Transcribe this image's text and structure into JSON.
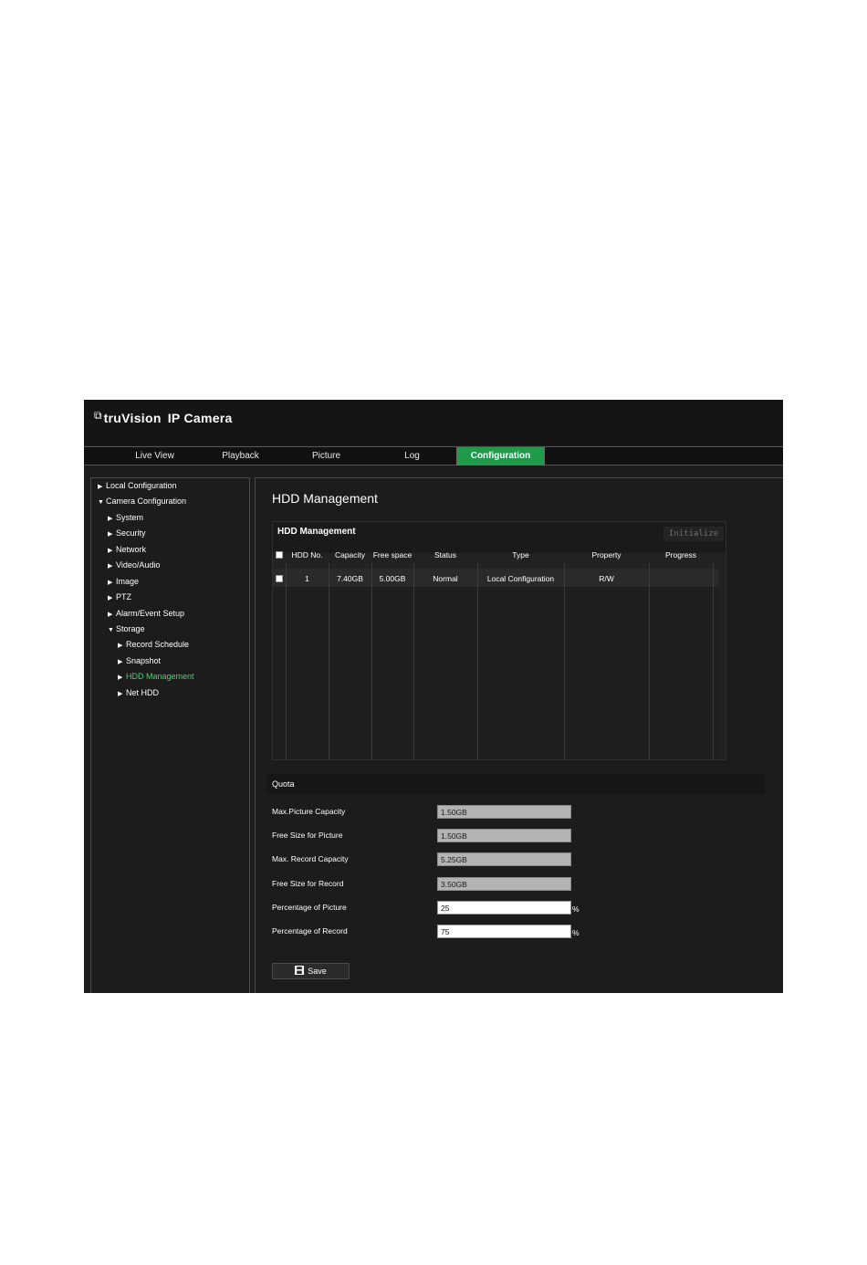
{
  "header": {
    "logo_mark": "⧉",
    "brand": "truVision",
    "product": "IP Camera"
  },
  "nav": {
    "tabs": [
      {
        "label": "Live View"
      },
      {
        "label": "Playback"
      },
      {
        "label": "Picture"
      },
      {
        "label": "Log"
      },
      {
        "label": "Configuration",
        "active": true
      }
    ]
  },
  "sidebar": {
    "items": [
      {
        "label": "Local Configuration",
        "arrow": "▶",
        "level": 0
      },
      {
        "label": "Camera Configuration",
        "arrow": "▼",
        "level": 0
      },
      {
        "label": "System",
        "arrow": "▶",
        "level": 1
      },
      {
        "label": "Security",
        "arrow": "▶",
        "level": 1
      },
      {
        "label": "Network",
        "arrow": "▶",
        "level": 1
      },
      {
        "label": "Video/Audio",
        "arrow": "▶",
        "level": 1
      },
      {
        "label": "Image",
        "arrow": "▶",
        "level": 1
      },
      {
        "label": "PTZ",
        "arrow": "▶",
        "level": 1
      },
      {
        "label": "Alarm/Event Setup",
        "arrow": "▶",
        "level": 1
      },
      {
        "label": "Storage",
        "arrow": "▼",
        "level": 1
      },
      {
        "label": "Record Schedule",
        "arrow": "▶",
        "level": 2
      },
      {
        "label": "Snapshot",
        "arrow": "▶",
        "level": 2
      },
      {
        "label": "HDD Management",
        "arrow": "▶",
        "level": 2,
        "active": true
      },
      {
        "label": "Net HDD",
        "arrow": "▶",
        "level": 2
      }
    ],
    "active_color": "#4cd06f"
  },
  "page": {
    "title": "HDD Management"
  },
  "hdd": {
    "panel_title": "HDD Management",
    "initialize_label": "Initialize",
    "columns": [
      "HDD No.",
      "Capacity",
      "Free space",
      "Status",
      "Type",
      "Property",
      "Progress"
    ],
    "rows": [
      {
        "no": "1",
        "capacity": "7.40GB",
        "free": "5.00GB",
        "status": "Normal",
        "type": "Local Configuration",
        "property": "R/W",
        "progress": ""
      }
    ]
  },
  "quota": {
    "title": "Quota",
    "fields": [
      {
        "label": "Max.Picture Capacity",
        "value": "1.50GB",
        "editable": false,
        "unit": ""
      },
      {
        "label": "Free Size for Picture",
        "value": "1.50GB",
        "editable": false,
        "unit": ""
      },
      {
        "label": "Max. Record Capacity",
        "value": "5.25GB",
        "editable": false,
        "unit": ""
      },
      {
        "label": "Free Size for Record",
        "value": "3.50GB",
        "editable": false,
        "unit": ""
      },
      {
        "label": "Percentage of Picture",
        "value": "25",
        "editable": true,
        "unit": "%"
      },
      {
        "label": "Percentage of Record",
        "value": "75",
        "editable": true,
        "unit": "%"
      }
    ]
  },
  "actions": {
    "save_label": "Save",
    "save_icon": "save-icon"
  },
  "colors": {
    "accent": "#1f9a4a",
    "background": "#1c1c1c"
  }
}
